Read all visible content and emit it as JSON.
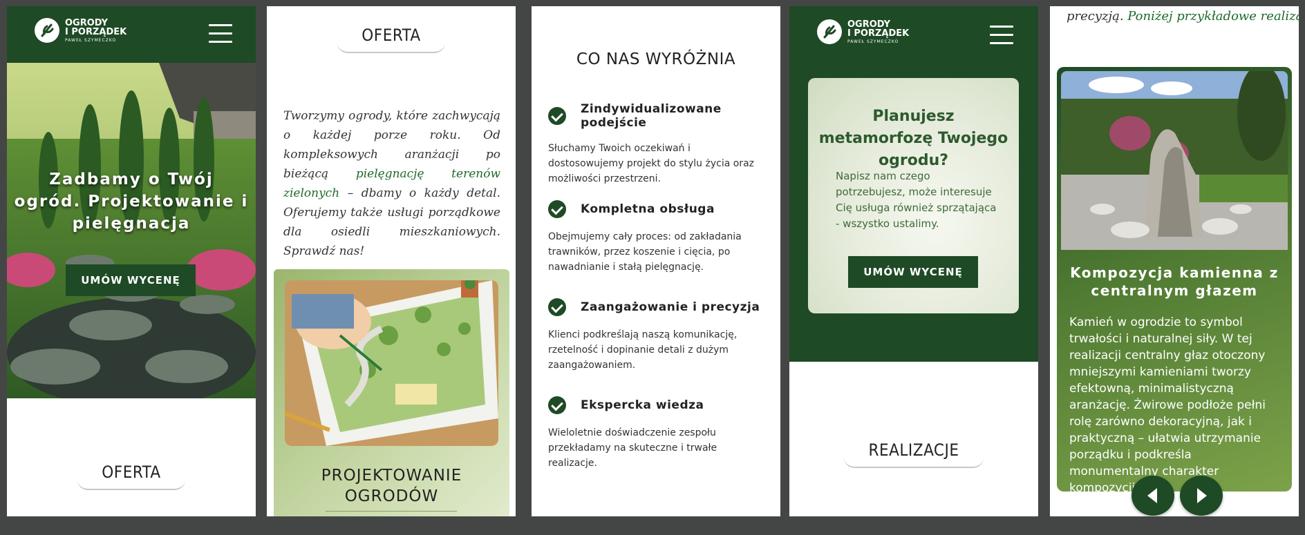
{
  "brand": {
    "line1": "OGRODY",
    "line2": "I PORZĄDEK",
    "line3": "PAWEŁ SZYMECZKO"
  },
  "panel1": {
    "hero_title": "Zadbamy o Twój ogród. Projektowanie i pielęgnacja",
    "cta_label": "UMÓW WYCENĘ",
    "section_label": "OFERTA"
  },
  "panel2": {
    "section_label": "OFERTA",
    "intro_part1": "Tworzymy ogrody, które zachwycają o każdej porze roku. Od kompleksowych aranżacji po bieżącą ",
    "intro_link": "pielęgnację terenów zielonych",
    "intro_part2": " – dbamy o każdy detal. Oferujemy także usługi porządkowe dla osiedli mieszkaniowych. Sprawdź nas!",
    "card_title_line1": "PROJEKTOWANIE",
    "card_title_line2": "OGRODÓW"
  },
  "panel3": {
    "heading": "CO NAS WYRÓŻNIA",
    "features": [
      {
        "title": "Zindywidualizowane podejście",
        "desc": "Słuchamy Twoich oczekiwań i dostosowujemy projekt do stylu życia oraz możliwości przestrzeni."
      },
      {
        "title": "Kompletna obsługa",
        "desc": "Obejmujemy cały proces: od zakładania trawników, przez koszenie i cięcia, po nawadnianie i stałą pielęgnację."
      },
      {
        "title": "Zaangażowanie i precyzja",
        "desc": "Klienci podkreślają naszą komunikację, rzetelność i dopinanie detali z dużym zaangażowaniem."
      },
      {
        "title": "Ekspercka wiedza",
        "desc": "Wieloletnie doświadczenie zespołu przekładamy na skuteczne i trwałe realizacje."
      }
    ]
  },
  "panel4": {
    "cta_title": "Planujesz metamorfozę Twojego ogrodu?",
    "cta_text": "Napisz nam czego potrzebujesz, może interesuje Cię usługa również sprzątająca - wszystko ustalimy.",
    "cta_button": "UMÓW WYCENĘ",
    "section_label": "REALIZACJE"
  },
  "panel5": {
    "top_text_plain": "precyzją. ",
    "top_text_link": "Poniżej przykładowe realizacje",
    "card_title": "Kompozycja kamienna z centralnym głazem",
    "card_text": "Kamień w ogrodzie to symbol trwałości i naturalnej siły. W tej realizacji centralny głaz otoczony mniejszymi kamieniami tworzy efektowną, minimalistyczną aranżację. Żwirowe podłoże pełni rolę zarówno dekoracyjną, jak i praktyczną – ułatwia utrzymanie porządku i podkreśla monumentalny charakter kompozycji."
  },
  "colors": {
    "brand_green": "#1e4a25",
    "link_green": "#1e6a2a",
    "card_light": "#c8d9a8"
  }
}
